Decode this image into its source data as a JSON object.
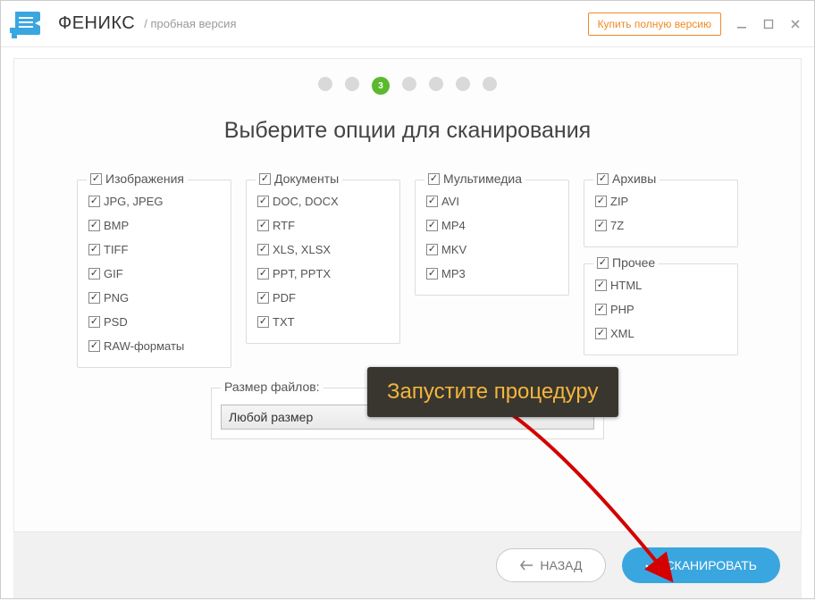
{
  "titlebar": {
    "app_name": "ФЕНИКС",
    "trial_label": "/ пробная версия",
    "buy_label": "Купить полную версию"
  },
  "stepper": {
    "current": 3,
    "current_label": "3",
    "total": 7
  },
  "page_title": "Выберите опции для сканирования",
  "groups": {
    "images": {
      "title": "Изображения",
      "items": [
        "JPG, JPEG",
        "BMP",
        "TIFF",
        "GIF",
        "PNG",
        "PSD",
        "RAW-форматы"
      ]
    },
    "docs": {
      "title": "Документы",
      "items": [
        "DOC, DOCX",
        "RTF",
        "XLS, XLSX",
        "PPT, PPTX",
        "PDF",
        "TXT"
      ]
    },
    "media": {
      "title": "Мультимедиа",
      "items": [
        "AVI",
        "MP4",
        "MKV",
        "MP3"
      ]
    },
    "arch": {
      "title": "Архивы",
      "items": [
        "ZIP",
        "7Z"
      ]
    },
    "other": {
      "title": "Прочее",
      "items": [
        "HTML",
        "PHP",
        "XML"
      ]
    }
  },
  "size": {
    "legend": "Размер файлов:",
    "value": "Любой размер"
  },
  "footer": {
    "back": "НАЗАД",
    "scan": "СКАНИРОВАТЬ"
  },
  "callout": "Запустите процедуру"
}
